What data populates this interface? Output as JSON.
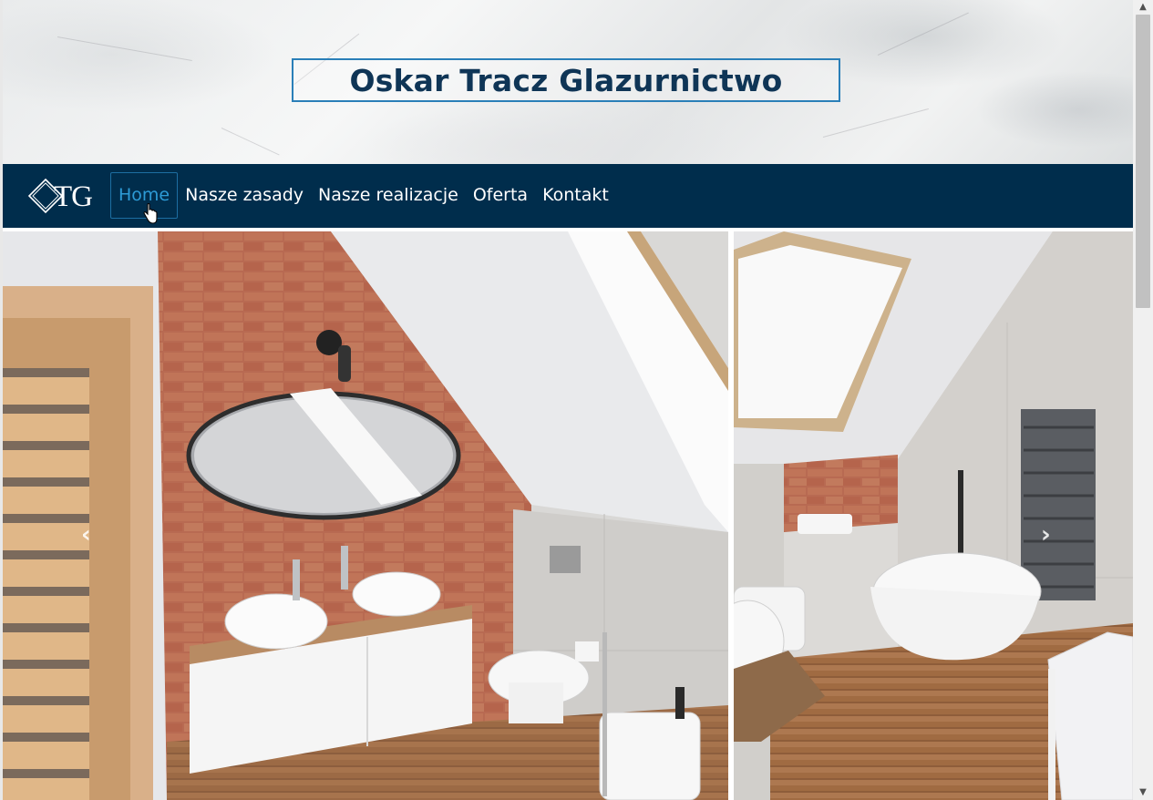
{
  "header": {
    "title": "Oskar Tracz Glazurnictwo"
  },
  "logo": {
    "text": "TG"
  },
  "nav": {
    "items": [
      {
        "label": "Home",
        "active": true
      },
      {
        "label": "Nasze zasady",
        "active": false
      },
      {
        "label": "Nasze realizacje",
        "active": false
      },
      {
        "label": "Oferta",
        "active": false
      },
      {
        "label": "Kontakt",
        "active": false
      }
    ]
  },
  "carousel": {
    "prev_icon": "chevron-left-icon",
    "next_icon": "chevron-right-icon",
    "slides": [
      "bathroom-vanity-photo",
      "bathroom-bathtub-photo"
    ]
  },
  "colors": {
    "nav_bg": "#002d4c",
    "title_text": "#0f3556",
    "title_border": "#2a7fb8",
    "active_link": "#2d9bd6"
  }
}
